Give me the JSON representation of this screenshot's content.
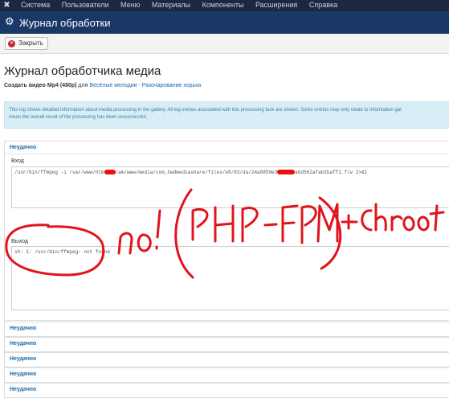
{
  "topmenu": {
    "items": [
      "Система",
      "Пользователи",
      "Меню",
      "Материалы",
      "Компоненты",
      "Расширения",
      "Справка"
    ]
  },
  "header": {
    "title": "Журнал обработки"
  },
  "toolbar": {
    "close_label": "Закрыть"
  },
  "page": {
    "heading": "Журнал обработчика медиа",
    "subtitle_bold": "Создать видео Mp4 (480p)",
    "subtitle_for": "для",
    "subtitle_link": "Весёлые мелодии - Разочарование хорька"
  },
  "info": {
    "text_line1": "This log shows detailed information about media processing in the gallery. All log entries associated with this processing task are shown. Some entries may only relate to information gat",
    "text_line2": "mean the overall result of the processing has been unsuccessful."
  },
  "log": {
    "entries": [
      {
        "status": "Неудачно",
        "input_label": "Вход",
        "input_part1": "/usr/bin/ffmpeg -i /var/www/htm",
        "input_part2": "/am/www/media/com_hwdmediashare/files/e9/83/da/24a9859e3",
        "input_part3": "a6d562afab2baff1.flv 2>&1",
        "output_label": "Выход",
        "output_value": "sh: 1: /usr/bin/ffmpeg: not found"
      }
    ],
    "collapsed_rows": [
      "Неудачно",
      "Неудачно",
      "Неудачно",
      "Неудачно",
      "Неудачно"
    ]
  },
  "annotation": {
    "text": "no! (PHP-FPM) +Chroot",
    "color": "#e0141c"
  }
}
